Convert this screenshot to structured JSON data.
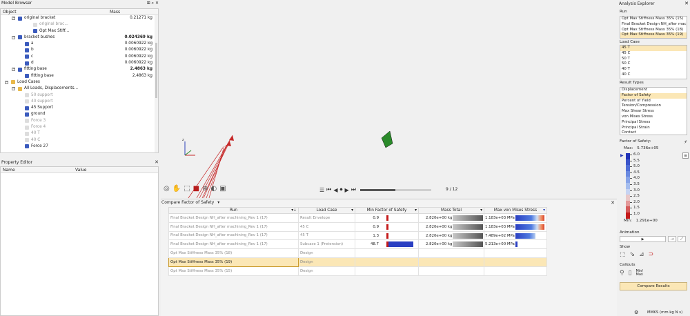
{
  "model_browser": {
    "title": "Model Browser",
    "col_object": "Object",
    "col_mass": "Mass",
    "rows": [
      {
        "label": "original bracket",
        "mass": "0.21271 kg",
        "indent": 34,
        "bold": false,
        "dim": false
      },
      {
        "label": "original brac...",
        "mass": "",
        "indent": 56,
        "bold": false,
        "dim": true
      },
      {
        "label": "Opt Max Stiff...",
        "mass": "",
        "indent": 56,
        "bold": false,
        "dim": false
      },
      {
        "label": "bracket bushes",
        "mass": "0.024369 kg",
        "indent": 34,
        "bold": false,
        "dim": false,
        "mass_bold": true
      },
      {
        "label": "a",
        "mass": "0.0060922 kg",
        "indent": 44,
        "bold": false,
        "dim": false
      },
      {
        "label": "b",
        "mass": "0.0060922 kg",
        "indent": 44,
        "bold": false,
        "dim": false
      },
      {
        "label": "c",
        "mass": "0.0060922 kg",
        "indent": 44,
        "bold": false,
        "dim": false
      },
      {
        "label": "d",
        "mass": "0.0060922 kg",
        "indent": 44,
        "bold": false,
        "dim": false
      },
      {
        "label": "fitting base",
        "mass": "2.4863 kg",
        "indent": 34,
        "bold": false,
        "dim": false,
        "mass_bold": true
      },
      {
        "label": "fitting base",
        "mass": "2.4863 kg",
        "indent": 44,
        "bold": false,
        "dim": false
      },
      {
        "label": "Load Cases",
        "mass": "",
        "indent": 24,
        "bold": false,
        "dim": false
      },
      {
        "label": "All Loads, Displacements...",
        "mass": "",
        "indent": 34,
        "bold": false,
        "dim": false
      },
      {
        "label": "50 support",
        "mass": "",
        "indent": 44,
        "bold": false,
        "dim": true
      },
      {
        "label": "40 support",
        "mass": "",
        "indent": 44,
        "bold": false,
        "dim": true
      },
      {
        "label": "45 Support",
        "mass": "",
        "indent": 44,
        "bold": false,
        "dim": false
      },
      {
        "label": "ground",
        "mass": "",
        "indent": 44,
        "bold": false,
        "dim": false
      },
      {
        "label": "Force 3",
        "mass": "",
        "indent": 44,
        "bold": false,
        "dim": true
      },
      {
        "label": "Force 4",
        "mass": "",
        "indent": 44,
        "bold": false,
        "dim": true
      },
      {
        "label": "40 T",
        "mass": "",
        "indent": 44,
        "bold": false,
        "dim": true
      },
      {
        "label": "40 C",
        "mass": "",
        "indent": 44,
        "bold": false,
        "dim": true
      },
      {
        "label": "Force 27",
        "mass": "",
        "indent": 44,
        "bold": false,
        "dim": false
      }
    ]
  },
  "property_editor": {
    "title": "Property Editor",
    "col_name": "Name",
    "col_value": "Value"
  },
  "player": {
    "counter": "9 / 12",
    "progress": 0.5
  },
  "compare": {
    "title": "Compare Factor of Safety",
    "columns": [
      "Run",
      "Load Case",
      "Min Factor of Safety",
      "Mass Total",
      "Max von Mises Stress"
    ],
    "rows": [
      {
        "run": "Final Bracket Design NH_after machining_Rev 1 (17)",
        "load_case": "Result Envelope",
        "fos": "0.9",
        "fos_frac": 0.03,
        "mass": "2.820e+00 kg",
        "stress": "1.183e+03 MPa",
        "stress_frac": 1.0,
        "stress_tip": true
      },
      {
        "run": "Final Bracket Design NH_after machining_Rev 1 (17)",
        "load_case": "45 C",
        "fos": "0.9",
        "fos_frac": 0.03,
        "mass": "2.820e+00 kg",
        "stress": "1.183e+03 MPa",
        "stress_frac": 1.0,
        "stress_tip": true
      },
      {
        "run": "Final Bracket Design NH_after machining_Rev 1 (17)",
        "load_case": "45 T",
        "fos": "1.3",
        "fos_frac": 0.03,
        "mass": "2.820e+00 kg",
        "stress": "7.489e+02 MPa",
        "stress_frac": 0.7,
        "stress_tip": false
      },
      {
        "run": "Final Bracket Design NH_after machining_Rev 1 (17)",
        "load_case": "Subcase 1 (Pretension)",
        "fos": "48.7",
        "fos_frac": 1.0,
        "mass": "2.820e+00 kg",
        "stress": "5.213e+00 MPa",
        "stress_frac": 0.08,
        "stress_tip": false
      },
      {
        "run": "Opt Max Stiffness Mass 35% (18)",
        "load_case": "Design",
        "fos": "",
        "mass": "",
        "stress": ""
      },
      {
        "run": "Opt Max Stiffness Mass 35% (19)",
        "load_case": "Design",
        "fos": "",
        "mass": "",
        "stress": "",
        "selected": true
      },
      {
        "run": "Opt Max Stiffness Mass 35% (15)",
        "load_case": "Design",
        "fos": "",
        "mass": "",
        "stress": ""
      }
    ]
  },
  "analysis": {
    "title": "Analysis Explorer",
    "run_label": "Run",
    "runs": [
      "Opt Max Stiffness Mass 35% (15)",
      "Final Bracket Design NH_after mac...",
      "Opt Max Stiffness Mass 35% (18)",
      "Opt Max Stiffness Mass 35% (19)"
    ],
    "runs_selected": 3,
    "loadcase_label": "Load Case",
    "load_cases": [
      "45 T",
      "45 C",
      "50 T",
      "50 C",
      "40 T",
      "40 C"
    ],
    "lc_selected": 0,
    "result_label": "Result Types",
    "result_types": [
      "Displacement",
      "Factor of Safety",
      "Percent of Yield",
      "Tension/Compression",
      "Max Shear Stress",
      "von Mises Stress",
      "Principal Stress",
      "Principal Strain",
      "Contact"
    ],
    "rt_selected": 1,
    "fos_label": "Factor of Safety:",
    "max_label": "Max:",
    "max_value": "5.736e+05",
    "min_label": "Min:",
    "min_value": "1.291e+00",
    "legend": [
      "6.0",
      "5.5",
      "5.0",
      "4.5",
      "4.0",
      "3.5",
      "3.0",
      "2.5",
      "2.0",
      "1.5",
      "1.0"
    ],
    "legend_colors": [
      "#2133b8",
      "#3a54c9",
      "#4f6ed6",
      "#6a8ae0",
      "#87a4e8",
      "#a5bdee",
      "#c6d4f3",
      "#e9c8c8",
      "#e39a9a",
      "#d55c5c",
      "#c41b1b"
    ],
    "animation_label": "Animation",
    "show_label": "Show",
    "callouts_label": "Callouts",
    "minmax_label": "Min/ Max",
    "compare_button": "Compare Results",
    "units": "MMKS (mm kg N s)"
  }
}
